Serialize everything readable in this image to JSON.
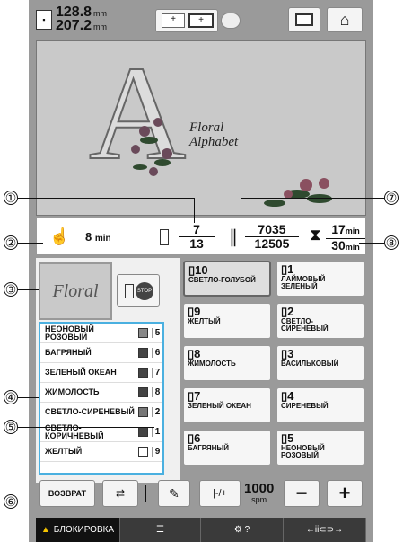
{
  "dims": {
    "height": "128.8",
    "width": "207.2",
    "unit": "mm"
  },
  "status": {
    "time_label": "8",
    "time_unit": "min",
    "stitch_current": "7",
    "stitch_total": "13",
    "count_current": "7035",
    "count_total": "12505",
    "time_cur": "17",
    "time_total": "30",
    "min": "min"
  },
  "callouts": {
    "c1": "①",
    "c2": "②",
    "c3": "③",
    "c4": "④",
    "c5": "⑤",
    "c6": "⑥",
    "c7": "⑦",
    "c8": "⑧"
  },
  "preview": {
    "line1": "Floral",
    "line2": "Alphabet"
  },
  "thumb": "Floral",
  "colorlist": [
    {
      "name": "НЕОНОВЫЙ РОЗОВЫЙ",
      "num": "5",
      "color": "#888"
    },
    {
      "name": "БАГРЯНЫЙ",
      "num": "6",
      "color": "#444"
    },
    {
      "name": "ЗЕЛЕНЫЙ ОКЕАН",
      "num": "7",
      "color": "#444"
    },
    {
      "name": "ЖИМОЛОСТЬ",
      "num": "8",
      "color": "#444"
    },
    {
      "name": "СВЕТЛО-СИРЕНЕВЫЙ",
      "num": "2",
      "color": "#777"
    },
    {
      "name": "СВЕТЛО-КОРИЧНЕВЫЙ",
      "num": "1",
      "color": "#444"
    },
    {
      "name": "ЖЕЛТЫЙ",
      "num": "9",
      "color": "#fff"
    }
  ],
  "colorbtns": [
    {
      "no": "10",
      "name": "СВЕТЛО-ГОЛУБОЙ",
      "sel": true
    },
    {
      "no": "1",
      "name": "ЛАЙМОВЫЙ ЗЕЛЕНЫЙ"
    },
    {
      "no": "9",
      "name": "ЖЕЛТЫЙ"
    },
    {
      "no": "2",
      "name": "СВЕТЛО-СИРЕНЕВЫЙ"
    },
    {
      "no": "8",
      "name": "ЖИМОЛОСТЬ"
    },
    {
      "no": "3",
      "name": "ВАСИЛЬКОВЫЙ"
    },
    {
      "no": "7",
      "name": "ЗЕЛЕНЫЙ ОКЕАН"
    },
    {
      "no": "4",
      "name": "СИРЕНЕВЫЙ"
    },
    {
      "no": "6",
      "name": "БАГРЯНЫЙ"
    },
    {
      "no": "5",
      "name": "НЕОНОВЫЙ РОЗОВЫЙ"
    }
  ],
  "bottom": {
    "return": "ВОЗВРАТ",
    "speed": "1000",
    "spm": "spm",
    "minus": "−",
    "plus": "+"
  },
  "tabs": {
    "lock": "БЛОКИРОВКА"
  }
}
